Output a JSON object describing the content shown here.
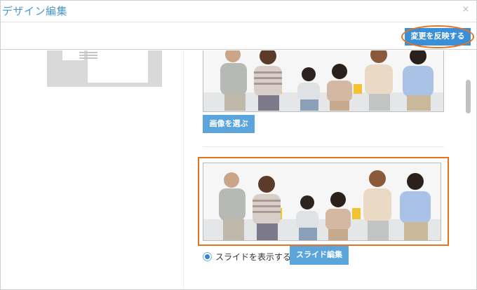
{
  "dialog": {
    "title": "デザイン編集",
    "close_glyph": "×"
  },
  "toolbar": {
    "apply_label": "変更を反映する"
  },
  "header_image": {
    "choose_label": "画像を選ぶ"
  },
  "slide": {
    "show_label": "スライドを表示する",
    "show_checked": true,
    "edit_label": "スライド編集"
  },
  "colors": {
    "accent": "#3a8fd6",
    "highlight": "#e8731f",
    "button": "#5ba4dc"
  }
}
